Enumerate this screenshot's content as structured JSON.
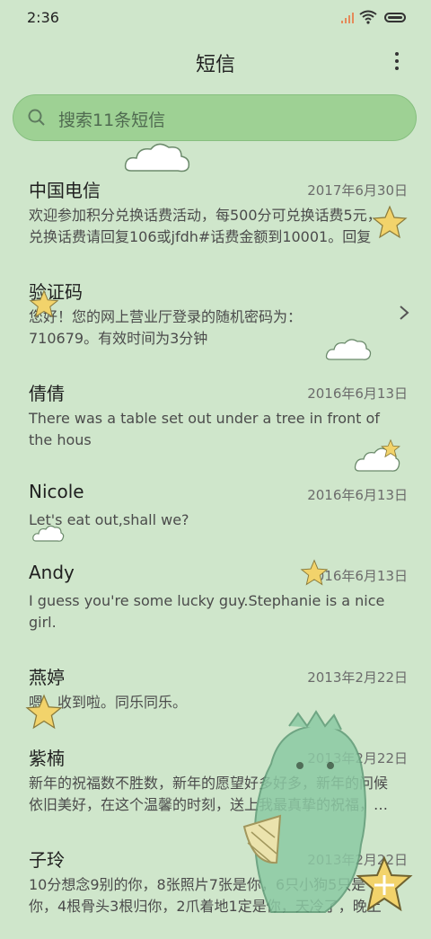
{
  "status": {
    "time": "2:36"
  },
  "header": {
    "title": "短信"
  },
  "search": {
    "placeholder": "搜索11条短信"
  },
  "messages": [
    {
      "name": "中国电信",
      "date": "2017年6月30日",
      "preview": "欢迎参加积分兑换话费活动，每500分可兑换话费5元，兑换话费请回复106或jfdh#话费金额到10001。回复"
    },
    {
      "name": "验证码",
      "date": "",
      "preview": "您好！您的网上营业厅登录的随机密码为：710679。有效时间为3分钟"
    },
    {
      "name": "倩倩",
      "date": "2016年6月13日",
      "preview": "There was a table set out under a tree in front of the hous"
    },
    {
      "name": "Nicole",
      "date": "2016年6月13日",
      "preview": "Let's eat out,shall we?"
    },
    {
      "name": "Andy",
      "date": "2016年6月13日",
      "preview": "I guess you're some lucky guy.Stephanie is a nice girl."
    },
    {
      "name": "燕婷",
      "date": "2013年2月22日",
      "preview": "嗯。收到啦。同乐同乐。"
    },
    {
      "name": "紫楠",
      "date": "2013年2月22日",
      "preview": "新年的祝福数不胜数，新年的愿望好多好多，新年的问候依旧美好，在这个温馨的时刻，送上我最真挚的祝福，…"
    },
    {
      "name": "子玲",
      "date": "2013年2月22日",
      "preview": "10分想念9别的你，8张照片7张是你，6只小狗5只是你，4根骨头3根归你，2爪着地1定是你，天冷了，晚上记得"
    }
  ],
  "icons": {
    "search": "search-icon",
    "more": "more-vertical-icon",
    "chevron": "chevron-right-icon",
    "compose": "compose-plus-icon"
  },
  "colors": {
    "background": "#cfe6cb",
    "search_fill": "#9ed194",
    "star": "#f2d36b"
  }
}
